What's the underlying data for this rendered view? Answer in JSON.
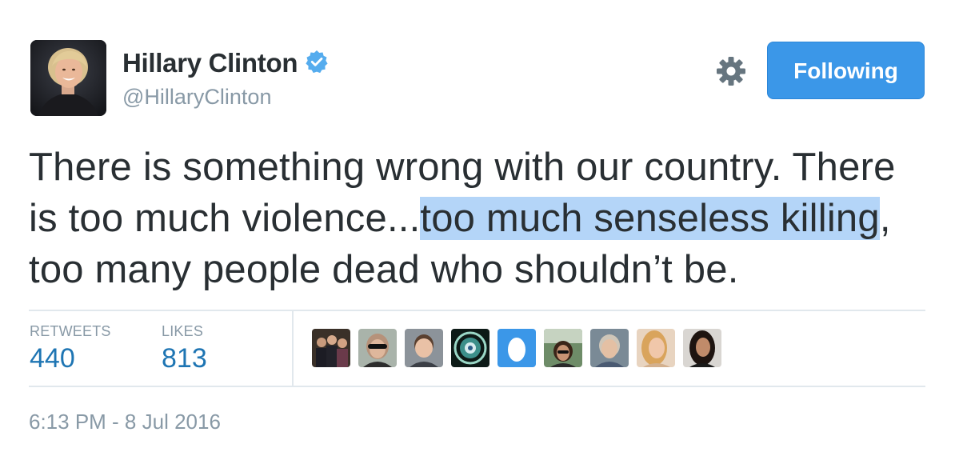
{
  "user": {
    "display_name": "Hillary Clinton",
    "handle": "@HillaryClinton",
    "verified": true,
    "verified_icon": "verified-badge-icon"
  },
  "actions": {
    "settings_icon": "gear-icon",
    "follow_label": "Following"
  },
  "tweet": {
    "text_before_highlight": "There is something wrong with our country. There is too much violence...",
    "text_highlighted": "too much senseless killing",
    "text_after_highlight": ", too many people dead who shouldn’t be."
  },
  "stats": {
    "retweets_label": "RETWEETS",
    "retweets_value": "440",
    "likes_label": "LIKES",
    "likes_value": "813"
  },
  "likers_count": 9,
  "timestamp": "6:13 PM - 8 Jul 2016",
  "colors": {
    "follow_button": "#3b97e8",
    "stat_value": "#1e75b3",
    "muted_text": "#8899a6",
    "highlight": "#b4d5f8",
    "divider": "#e1e8ed"
  }
}
